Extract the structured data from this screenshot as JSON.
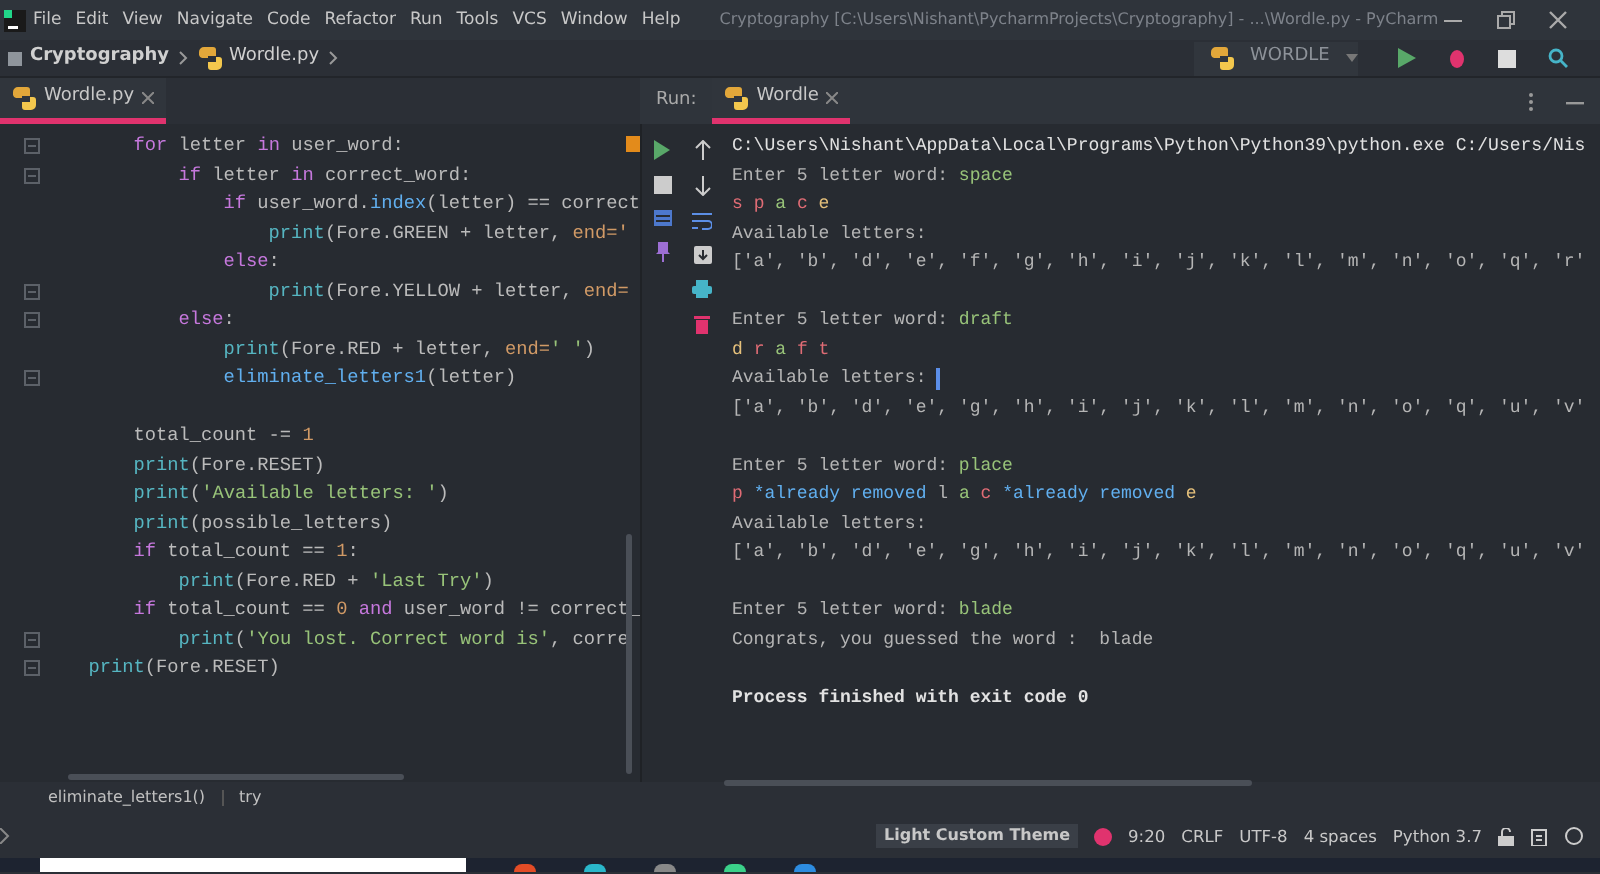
{
  "window": {
    "title": "Cryptography [C:\\Users\\Nishant\\PycharmProjects\\Cryptography] - ...\\Wordle.py - PyCharm"
  },
  "menu": [
    "File",
    "Edit",
    "View",
    "Navigate",
    "Code",
    "Refactor",
    "Run",
    "Tools",
    "VCS",
    "Window",
    "Help"
  ],
  "breadcrumb": [
    "Cryptography",
    "Wordle.py"
  ],
  "run_config": {
    "label": "WORDLE"
  },
  "editor_tabs": [
    {
      "label": "Wordle.py",
      "selected": true
    }
  ],
  "run_panel": {
    "label": "Run:",
    "tabs": [
      {
        "label": "Wordle",
        "selected": true
      }
    ]
  },
  "code_lines": [
    {
      "kind": "code",
      "fold": true,
      "tokens": [
        {
          "kind": "kw",
          "text": "    for"
        },
        {
          "kind": "plain",
          "text": " letter "
        },
        {
          "kind": "kw",
          "text": "in"
        },
        {
          "kind": "plain",
          "text": " user_word:"
        }
      ]
    },
    {
      "kind": "code",
      "fold": true,
      "tokens": [
        {
          "kind": "kw",
          "text": "        if"
        },
        {
          "kind": "plain",
          "text": " letter "
        },
        {
          "kind": "kw",
          "text": "in"
        },
        {
          "kind": "plain",
          "text": " correct_word:"
        }
      ]
    },
    {
      "kind": "code",
      "fold": false,
      "tokens": [
        {
          "kind": "kw",
          "text": "            if"
        },
        {
          "kind": "plain",
          "text": " user_word."
        },
        {
          "kind": "method",
          "text": "index"
        },
        {
          "kind": "plain",
          "text": "(letter) == correct"
        }
      ]
    },
    {
      "kind": "code",
      "fold": false,
      "tokens": [
        {
          "kind": "fn",
          "text": "                print"
        },
        {
          "kind": "plain",
          "text": "(Fore.GREEN + letter, "
        },
        {
          "kind": "kwarg",
          "text": "end='"
        }
      ]
    },
    {
      "kind": "code",
      "fold": false,
      "tokens": [
        {
          "kind": "kw",
          "text": "            else"
        },
        {
          "kind": "plain",
          "text": ":"
        }
      ]
    },
    {
      "kind": "code",
      "fold": true,
      "tokens": [
        {
          "kind": "fn",
          "text": "                print"
        },
        {
          "kind": "plain",
          "text": "(Fore.YELLOW + letter, "
        },
        {
          "kind": "kwarg",
          "text": "end="
        }
      ]
    },
    {
      "kind": "code",
      "fold": true,
      "tokens": [
        {
          "kind": "kw",
          "text": "        else"
        },
        {
          "kind": "plain",
          "text": ":"
        }
      ]
    },
    {
      "kind": "code",
      "fold": false,
      "tokens": [
        {
          "kind": "fn",
          "text": "            print"
        },
        {
          "kind": "plain",
          "text": "(Fore.RED + letter, "
        },
        {
          "kind": "kwarg",
          "text": "end="
        },
        {
          "kind": "str",
          "text": "' '"
        },
        {
          "kind": "plain",
          "text": ")"
        }
      ]
    },
    {
      "kind": "code",
      "fold": true,
      "tokens": [
        {
          "kind": "method",
          "text": "            eliminate_letters1"
        },
        {
          "kind": "plain",
          "text": "(letter)"
        }
      ]
    },
    {
      "kind": "blank"
    },
    {
      "kind": "code",
      "fold": false,
      "tokens": [
        {
          "kind": "plain",
          "text": "    total_count -= "
        },
        {
          "kind": "num",
          "text": "1"
        }
      ]
    },
    {
      "kind": "code",
      "fold": false,
      "tokens": [
        {
          "kind": "fn",
          "text": "    print"
        },
        {
          "kind": "plain",
          "text": "(Fore.RESET)"
        }
      ]
    },
    {
      "kind": "code",
      "fold": false,
      "tokens": [
        {
          "kind": "fn",
          "text": "    print"
        },
        {
          "kind": "plain",
          "text": "("
        },
        {
          "kind": "str",
          "text": "'Available letters: '"
        },
        {
          "kind": "plain",
          "text": ")"
        }
      ]
    },
    {
      "kind": "code",
      "fold": false,
      "tokens": [
        {
          "kind": "fn",
          "text": "    print"
        },
        {
          "kind": "plain",
          "text": "(possible_letters)"
        }
      ]
    },
    {
      "kind": "code",
      "fold": false,
      "tokens": [
        {
          "kind": "kw",
          "text": "    if"
        },
        {
          "kind": "plain",
          "text": " total_count == "
        },
        {
          "kind": "num",
          "text": "1"
        },
        {
          "kind": "plain",
          "text": ":"
        }
      ]
    },
    {
      "kind": "code",
      "fold": false,
      "tokens": [
        {
          "kind": "fn",
          "text": "        print"
        },
        {
          "kind": "plain",
          "text": "(Fore.RED + "
        },
        {
          "kind": "str",
          "text": "'Last Try'"
        },
        {
          "kind": "plain",
          "text": ")"
        }
      ]
    },
    {
      "kind": "code",
      "fold": false,
      "tokens": [
        {
          "kind": "kw",
          "text": "    if"
        },
        {
          "kind": "plain",
          "text": " total_count == "
        },
        {
          "kind": "num",
          "text": "0"
        },
        {
          "kind": "kw",
          "text": " and"
        },
        {
          "kind": "plain",
          "text": " user_word != correct_"
        }
      ]
    },
    {
      "kind": "code",
      "fold": true,
      "tokens": [
        {
          "kind": "fn",
          "text": "        print"
        },
        {
          "kind": "plain",
          "text": "("
        },
        {
          "kind": "str",
          "text": "'You lost. Correct word is'"
        },
        {
          "kind": "plain",
          "text": ", corre"
        }
      ]
    },
    {
      "kind": "code",
      "fold": true,
      "tokens": [
        {
          "kind": "fn",
          "text": "print"
        },
        {
          "kind": "plain",
          "text": "(Fore.RESET)"
        }
      ]
    }
  ],
  "console_lines": [
    {
      "kind": "text",
      "cursor": false,
      "segments": [
        {
          "kind": "system",
          "text": "C:\\Users\\Nishant\\AppData\\Local\\Programs\\Python\\Python39\\python.exe C:/Users/Nis"
        }
      ]
    },
    {
      "kind": "text",
      "cursor": false,
      "segments": [
        {
          "kind": "plain",
          "text": "Enter 5 letter word: "
        },
        {
          "kind": "input",
          "text": "space"
        }
      ]
    },
    {
      "kind": "text",
      "cursor": false,
      "segments": [
        {
          "kind": "red",
          "text": "s "
        },
        {
          "kind": "red",
          "text": "p "
        },
        {
          "kind": "green",
          "text": "a "
        },
        {
          "kind": "red",
          "text": "c "
        },
        {
          "kind": "yellow",
          "text": "e"
        }
      ]
    },
    {
      "kind": "text",
      "cursor": false,
      "segments": [
        {
          "kind": "plain",
          "text": "Available letters:"
        }
      ]
    },
    {
      "kind": "text",
      "cursor": false,
      "segments": [
        {
          "kind": "plain",
          "text": "['a', 'b', 'd', 'e', 'f', 'g', 'h', 'i', 'j', 'k', 'l', 'm', 'n', 'o', 'q', 'r'"
        }
      ]
    },
    {
      "kind": "blank"
    },
    {
      "kind": "text",
      "cursor": false,
      "segments": [
        {
          "kind": "plain",
          "text": "Enter 5 letter word: "
        },
        {
          "kind": "input",
          "text": "draft"
        }
      ]
    },
    {
      "kind": "text",
      "cursor": false,
      "segments": [
        {
          "kind": "yellow",
          "text": "d "
        },
        {
          "kind": "red",
          "text": "r "
        },
        {
          "kind": "green",
          "text": "a "
        },
        {
          "kind": "red",
          "text": "f "
        },
        {
          "kind": "red",
          "text": "t"
        }
      ]
    },
    {
      "kind": "text",
      "cursor": true,
      "segments": [
        {
          "kind": "plain",
          "text": "Available letters:"
        }
      ]
    },
    {
      "kind": "text",
      "cursor": false,
      "segments": [
        {
          "kind": "plain",
          "text": "['a', 'b', 'd', 'e', 'g', 'h', 'i', 'j', 'k', 'l', 'm', 'n', 'o', 'q', 'u', 'v'"
        }
      ]
    },
    {
      "kind": "blank"
    },
    {
      "kind": "text",
      "cursor": false,
      "segments": [
        {
          "kind": "plain",
          "text": "Enter 5 letter word: "
        },
        {
          "kind": "input",
          "text": "place"
        }
      ]
    },
    {
      "kind": "text",
      "cursor": false,
      "segments": [
        {
          "kind": "red",
          "text": "p "
        },
        {
          "kind": "note",
          "text": "*already removed "
        },
        {
          "kind": "plain",
          "text": "l "
        },
        {
          "kind": "green",
          "text": "a "
        },
        {
          "kind": "red",
          "text": "c "
        },
        {
          "kind": "note",
          "text": "*already removed "
        },
        {
          "kind": "yellow",
          "text": "e"
        }
      ]
    },
    {
      "kind": "text",
      "cursor": false,
      "segments": [
        {
          "kind": "plain",
          "text": "Available letters:"
        }
      ]
    },
    {
      "kind": "text",
      "cursor": false,
      "segments": [
        {
          "kind": "plain",
          "text": "['a', 'b', 'd', 'e', 'g', 'h', 'i', 'j', 'k', 'l', 'm', 'n', 'o', 'q', 'u', 'v'"
        }
      ]
    },
    {
      "kind": "blank"
    },
    {
      "kind": "text",
      "cursor": false,
      "segments": [
        {
          "kind": "plain",
          "text": "Enter 5 letter word: "
        },
        {
          "kind": "input",
          "text": "blade"
        }
      ]
    },
    {
      "kind": "text",
      "cursor": false,
      "segments": [
        {
          "kind": "plain",
          "text": "Congrats, you guessed the word :  blade"
        }
      ]
    },
    {
      "kind": "blank"
    },
    {
      "kind": "text",
      "cursor": false,
      "segments": [
        {
          "kind": "bold",
          "text": "Process finished with exit code 0"
        }
      ]
    }
  ],
  "editor_breadcrumb": [
    "eliminate_letters1()",
    "try"
  ],
  "status_bar": {
    "theme": "Light Custom Theme",
    "items": [
      "9:20",
      "CRLF",
      "UTF-8",
      "4 spaces",
      "Python 3.7"
    ]
  }
}
